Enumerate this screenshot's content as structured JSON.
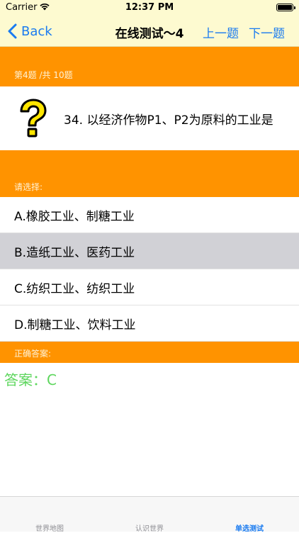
{
  "status_bar": {
    "carrier": "Carrier",
    "time": "12:37 PM"
  },
  "nav": {
    "back_label": "Back",
    "title": "在线测试～4",
    "prev_label": "上一题",
    "next_label": "下一题"
  },
  "progress": {
    "label": "第4题 /共 10题"
  },
  "question": {
    "text": "34.  以经济作物P1、P2为原料的工业是",
    "icon": "question-mark-icon"
  },
  "choose_label": "请选择:",
  "options": [
    {
      "label": "A.橡胶工业、制糖工业",
      "selected": false
    },
    {
      "label": "B.造纸工业、医药工业",
      "selected": true
    },
    {
      "label": "C.纺织工业、纺织工业",
      "selected": false
    },
    {
      "label": "D.制糖工业、饮料工业",
      "selected": false
    }
  ],
  "answer": {
    "section_label": "正确答案:",
    "text": "答案：C"
  },
  "tabs": [
    {
      "label": "世界地图",
      "active": false
    },
    {
      "label": "认识世界",
      "active": false
    },
    {
      "label": "单选测试",
      "active": true
    }
  ],
  "colors": {
    "header_bg": "#fdfad0",
    "accent": "#1a7bf0",
    "orange": "#ff9300",
    "answer_green": "#5dd65d",
    "selected_bg": "#d1d1d6"
  }
}
